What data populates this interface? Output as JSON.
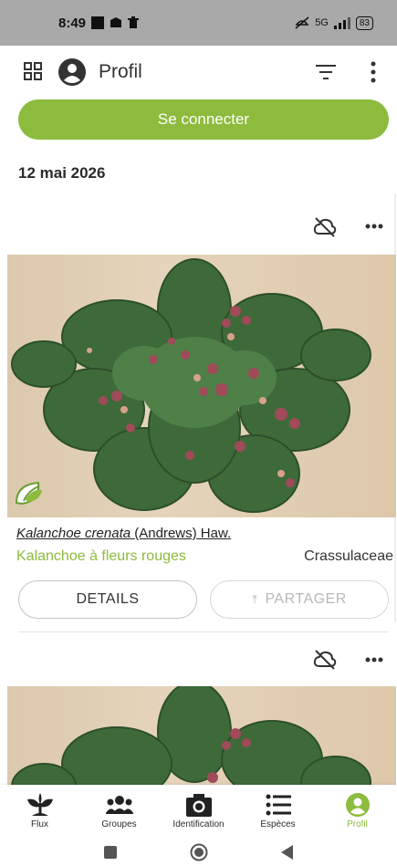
{
  "status": {
    "time": "8:49",
    "network": "5G",
    "battery": "83"
  },
  "header": {
    "title": "Profil"
  },
  "connect_label": "Se connecter",
  "date": "12 mai 2026",
  "observation": {
    "scientific_name": "Kalanchoe crenata",
    "authority": "(Andrews) Haw.",
    "common_name": "Kalanchoe à fleurs rouges",
    "family": "Crassulaceae",
    "details_label": "DETAILS",
    "share_label": "PARTAGER"
  },
  "nav": {
    "items": [
      {
        "label": "Flux",
        "icon": "plant-icon"
      },
      {
        "label": "Groupes",
        "icon": "groups-icon"
      },
      {
        "label": "Identification",
        "icon": "camera-icon"
      },
      {
        "label": "Espèces",
        "icon": "list-icon"
      },
      {
        "label": "Profil",
        "icon": "profile-icon"
      }
    ]
  },
  "colors": {
    "accent": "#8dbb3d",
    "statusbar": "#a9a9a9"
  }
}
